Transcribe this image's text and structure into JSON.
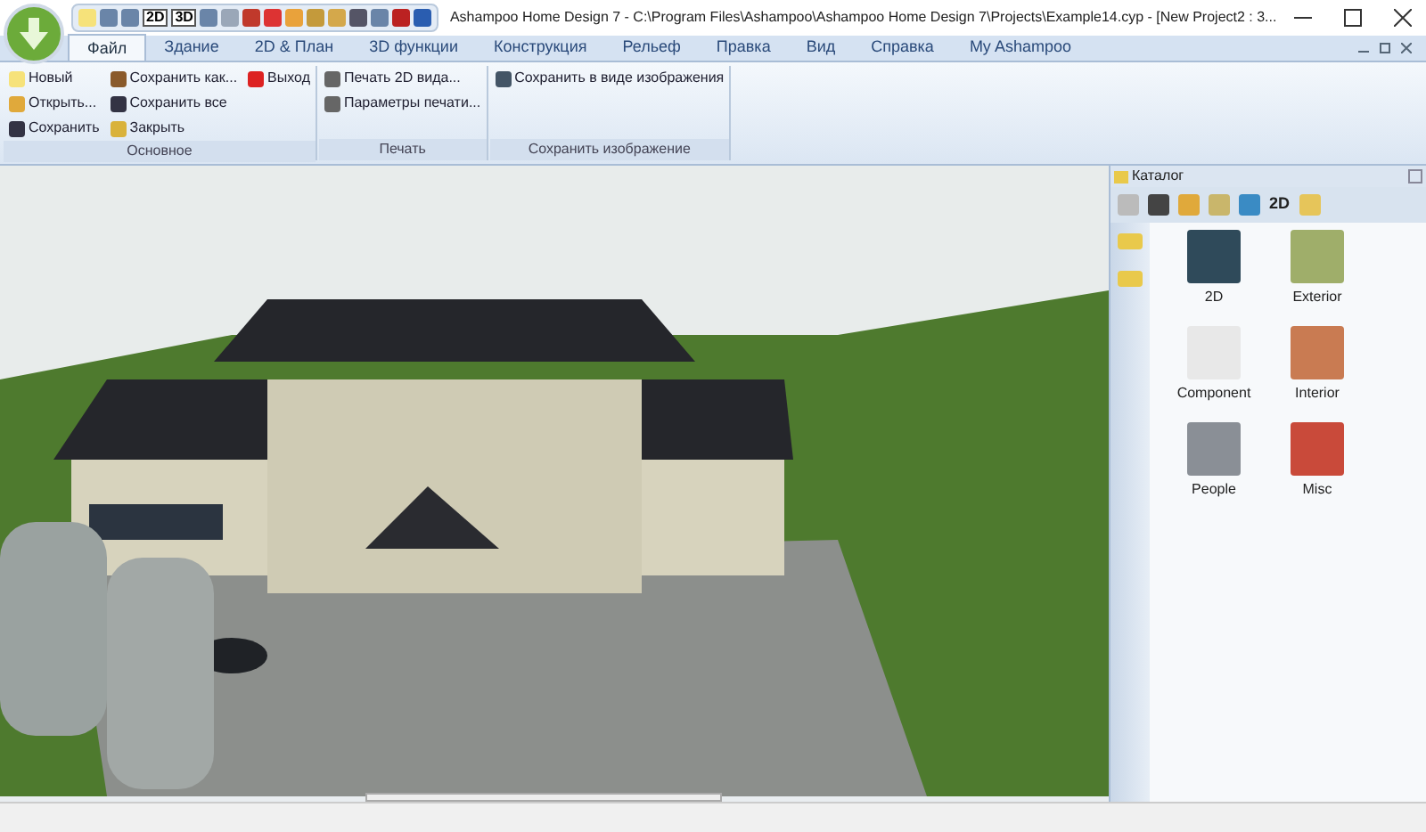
{
  "window": {
    "title": "Ashampoo Home Design 7 - C:\\Program Files\\Ashampoo\\Ashampoo Home Design 7\\Projects\\Example14.cyp - [New Project2 : 3..."
  },
  "quick_toolbar": [
    {
      "kind": "icon"
    },
    {
      "kind": "icon"
    },
    {
      "kind": "icon"
    },
    {
      "kind": "text",
      "label": "2D"
    },
    {
      "kind": "text",
      "label": "3D"
    },
    {
      "kind": "icon"
    },
    {
      "kind": "icon"
    },
    {
      "kind": "icon"
    },
    {
      "kind": "icon"
    },
    {
      "kind": "icon"
    },
    {
      "kind": "icon"
    },
    {
      "kind": "icon"
    },
    {
      "kind": "icon"
    },
    {
      "kind": "icon"
    },
    {
      "kind": "icon"
    },
    {
      "kind": "icon"
    }
  ],
  "tabs": [
    {
      "label": "Файл",
      "selected": true
    },
    {
      "label": "Здание",
      "selected": false
    },
    {
      "label": "2D & План",
      "selected": false
    },
    {
      "label": "3D функции",
      "selected": false
    },
    {
      "label": "Конструкция",
      "selected": false
    },
    {
      "label": "Рельеф",
      "selected": false
    },
    {
      "label": "Правка",
      "selected": false
    },
    {
      "label": "Вид",
      "selected": false
    },
    {
      "label": "Справка",
      "selected": false
    },
    {
      "label": "My Ashampoo",
      "selected": false
    }
  ],
  "ribbon_groups": [
    {
      "label": "Основное",
      "columns": [
        [
          "Новый",
          "Открыть...",
          "Сохранить"
        ],
        [
          "Сохранить как...",
          "Сохранить все",
          "Закрыть"
        ],
        [
          "Выход"
        ]
      ]
    },
    {
      "label": "Печать",
      "columns": [
        [
          "Печать 2D вида...",
          "Параметры печати..."
        ]
      ]
    },
    {
      "label": "Сохранить изображение",
      "columns": [
        [
          "Сохранить в виде изображения"
        ]
      ]
    }
  ],
  "catalog": {
    "title": "Каталог",
    "toolbar_text": "2D",
    "items": [
      {
        "label": "2D"
      },
      {
        "label": "Exterior"
      },
      {
        "label": "Component"
      },
      {
        "label": "Interior"
      },
      {
        "label": "People"
      },
      {
        "label": "Misc"
      }
    ]
  }
}
